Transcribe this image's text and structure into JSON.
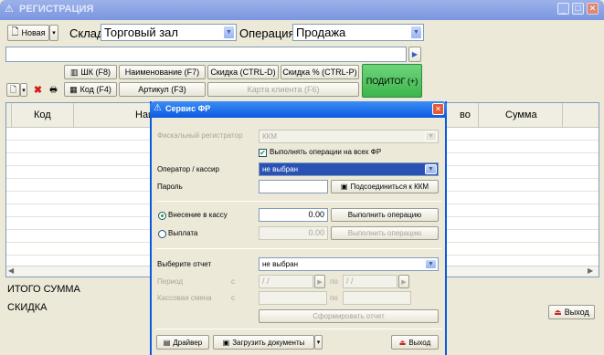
{
  "window": {
    "title": "РЕГИСТРАЦИЯ",
    "minimize": "_",
    "maximize": "□",
    "close": "✕"
  },
  "toolbar": {
    "new_label": "Новая",
    "warehouse_label": "Склад",
    "warehouse_value": "Торговый зал",
    "operation_label": "Операция",
    "operation_value": "Продажа"
  },
  "buttons": {
    "barcode": "ШК (F8)",
    "name": "Наименование (F7)",
    "discount": "Скидка (CTRL-D)",
    "discount_pct": "Скидка % (CTRL-P)",
    "code": "Код (F4)",
    "article": "Артикул (F3)",
    "client_card": "Карта клиента (F6)",
    "subtotal": "ПОДИТОГ (+)"
  },
  "table": {
    "col_code": "Код",
    "col_name_partial": "Наи",
    "col_qty_partial": "во",
    "col_sum": "Сумма"
  },
  "footer": {
    "total_label": "ИТОГО СУММА",
    "discount_label": "СКИДКА",
    "exit_label": "Выход"
  },
  "dialog": {
    "title": "Сервис ФР",
    "fiscal_label": "Фискальный регистратор",
    "fiscal_value": "ККМ",
    "all_fr_checkbox": "Выполнять операции на всех ФР",
    "operator_label": "Оператор / кассир",
    "operator_value": "не выбран",
    "password_label": "Пароль",
    "connect_button": "Подсоединиться к ККМ",
    "cash_in_label": "Внесение в кассу",
    "cash_in_amount": "0.00",
    "cash_in_button": "Выполнить операцию",
    "payout_label": "Выплата",
    "payout_amount": "0.00",
    "payout_button": "Выполнить операцию",
    "report_label": "Выберите отчет",
    "report_value": "не выбран",
    "period_label": "Период",
    "from_label": "с",
    "to_label": "по",
    "date_from": " / /",
    "date_to": " / /",
    "shift_label": "Кассовая смена",
    "shift_from_label": "с",
    "shift_to_label": "по",
    "generate_report_button": "Сформировать отчет",
    "driver_button": "Драйвер",
    "load_docs_button": "Загрузить документы",
    "exit_button": "Выход"
  },
  "colors": {
    "titlebar_inactive": "#7a96df",
    "titlebar_active": "#0a5ae0",
    "subtotal_green": "#3cb54c"
  }
}
